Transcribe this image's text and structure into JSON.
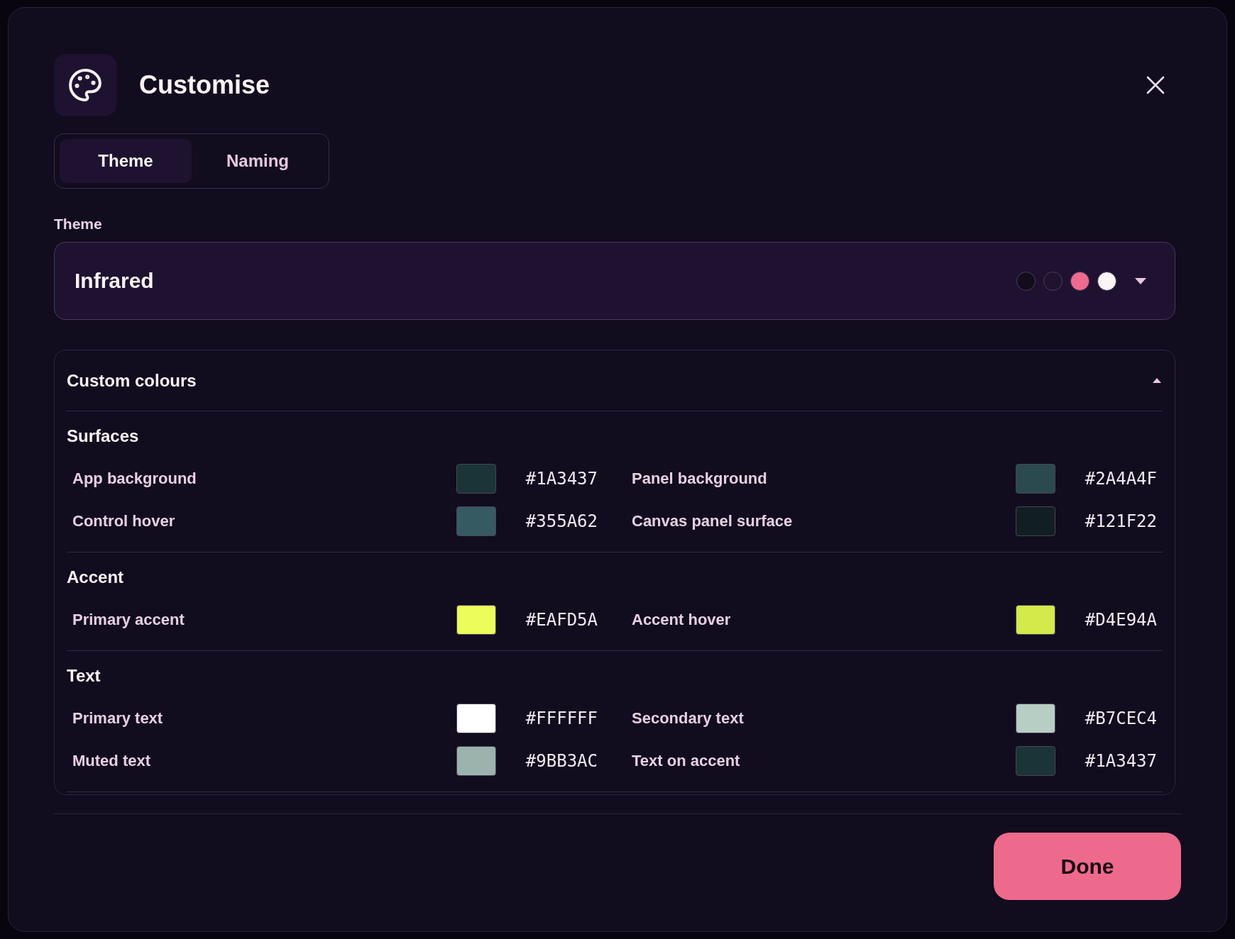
{
  "dialog": {
    "title": "Customise"
  },
  "tabs": [
    {
      "label": "Theme",
      "selected": true
    },
    {
      "label": "Naming",
      "selected": false
    }
  ],
  "theme": {
    "label": "Theme",
    "value": "Infrared",
    "preview": [
      {
        "color": "#120c1d"
      },
      {
        "color": "#1f1330"
      },
      {
        "color": "#ef6a8e"
      },
      {
        "color": "#fdf4f6"
      }
    ]
  },
  "custom_colours": {
    "title": "Custom colours",
    "expanded": true,
    "groups": [
      {
        "title": "Surfaces",
        "items": [
          {
            "label": "App background",
            "color": "#1a3437",
            "value": "#1A3437"
          },
          {
            "label": "Panel background",
            "color": "#2a4a4f",
            "value": "#2A4A4F"
          },
          {
            "label": "Control hover",
            "color": "#355a62",
            "value": "#355A62"
          },
          {
            "label": "Canvas panel surface",
            "color": "#121f22",
            "value": "#121F22"
          }
        ]
      },
      {
        "title": "Accent",
        "items": [
          {
            "label": "Primary accent",
            "color": "#eafd5a",
            "value": "#EAFD5A"
          },
          {
            "label": "Accent hover",
            "color": "#d4e94a",
            "value": "#D4E94A"
          }
        ]
      },
      {
        "title": "Text",
        "items": [
          {
            "label": "Primary text",
            "color": "#ffffff",
            "value": "#FFFFFF"
          },
          {
            "label": "Secondary text",
            "color": "#b7cec4",
            "value": "#B7CEC4"
          },
          {
            "label": "Muted text",
            "color": "#9bb3ac",
            "value": "#9BB3AC"
          },
          {
            "label": "Text on accent",
            "color": "#1a3437",
            "value": "#1A3437"
          }
        ]
      }
    ]
  },
  "footer": {
    "done_button": "Done"
  }
}
